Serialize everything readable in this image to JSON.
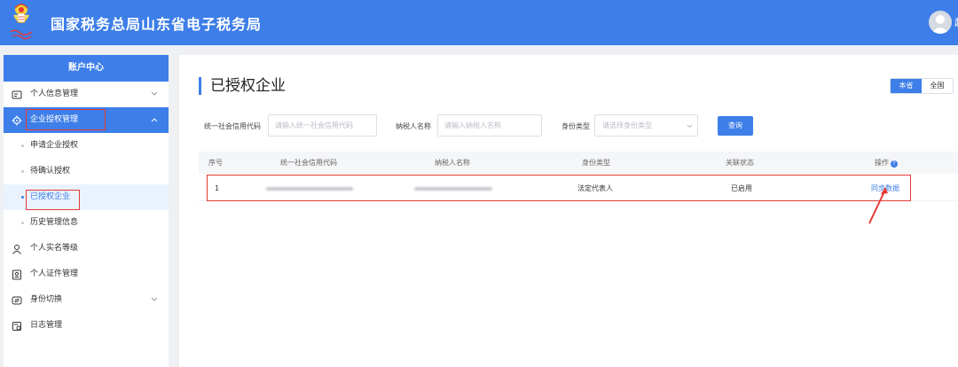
{
  "header": {
    "brand": "国家税务总局山东省电子税务局",
    "emblem_icon": "tax-emblem-icon",
    "user_initial": "赵"
  },
  "sidebar": {
    "title": "账户中心",
    "items": [
      {
        "label": "个人信息管理",
        "icon": "id-card-icon",
        "expandable": true
      },
      {
        "label": "企业授权管理",
        "icon": "gear-icon",
        "expandable": true,
        "active": true
      },
      {
        "label": "个人实名等级",
        "icon": "person-icon",
        "expandable": false
      },
      {
        "label": "个人证件管理",
        "icon": "document-icon",
        "expandable": false
      },
      {
        "label": "身份切换",
        "icon": "switch-icon",
        "expandable": true
      },
      {
        "label": "日志管理",
        "icon": "log-icon",
        "expandable": false
      }
    ],
    "sub_items": [
      {
        "label": "申请企业授权"
      },
      {
        "label": "待确认授权"
      },
      {
        "label": "已授权企业",
        "current": true
      },
      {
        "label": "历史管理信息"
      }
    ]
  },
  "main": {
    "title": "已授权企业",
    "scope": [
      "本省",
      "全国"
    ],
    "scope_selected": "本省",
    "filters": {
      "credit_code": {
        "label": "统一社会信用代码",
        "placeholder": "请输入统一社会信用代码",
        "value": ""
      },
      "taxpayer_name": {
        "label": "纳税人名称",
        "placeholder": "请输入纳税人名称",
        "value": ""
      },
      "identity_type": {
        "label": "身份类型",
        "placeholder": "请选择身份类型"
      }
    },
    "query_label": "查询",
    "table": {
      "columns": [
        "序号",
        "统一社会信用代码",
        "纳税人名称",
        "身份类型",
        "关联状态",
        "操作"
      ],
      "help_icon": "question-icon",
      "rows": [
        {
          "index": "1",
          "credit_code": "",
          "taxpayer_name": "",
          "identity_type": "法定代表人",
          "status": "已启用",
          "action": "同步数据"
        }
      ]
    }
  },
  "colors": {
    "primary": "#3d7ee8",
    "highlight": "#e53935"
  }
}
